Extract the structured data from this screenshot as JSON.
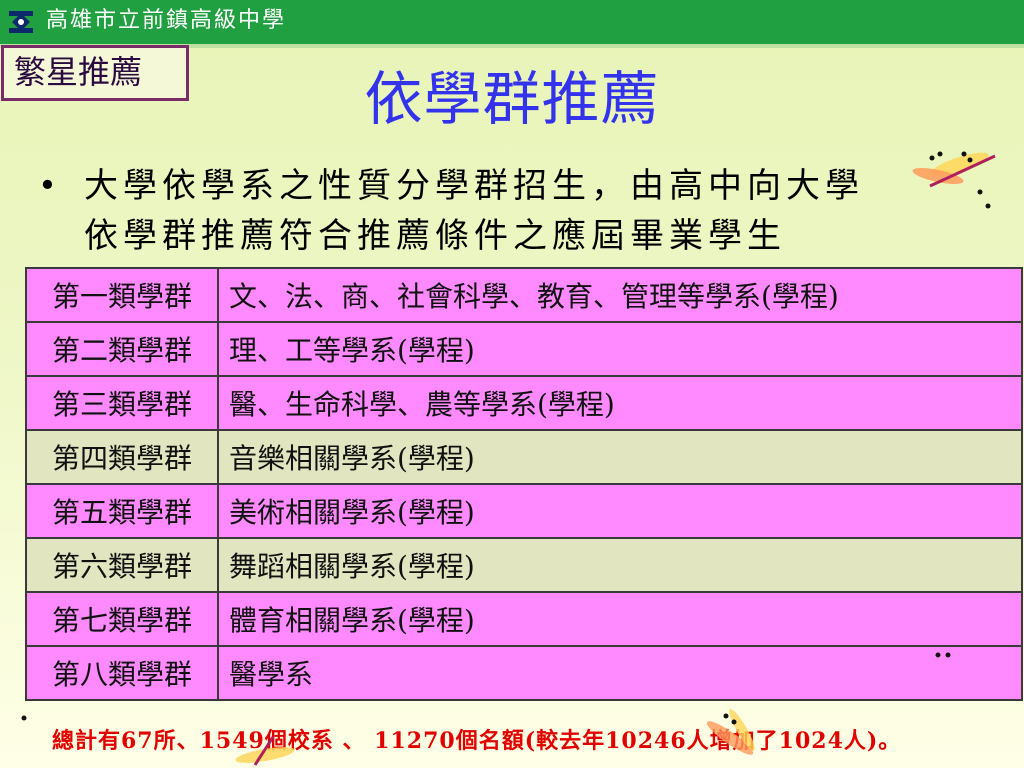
{
  "header": {
    "school_name": "高雄市立前鎮高級中學",
    "logo_icon": "school-emblem-icon",
    "background_color": "#21a041"
  },
  "tag": {
    "label": "繁星推薦"
  },
  "slide": {
    "title": "依學群推薦"
  },
  "bullet": {
    "line1": "大學依學系之性質分學群招生，由高中向大學",
    "line2": "依學群推薦符合推薦條件之應屆畢業學生"
  },
  "groups": [
    {
      "name": "第一類學群",
      "departments": "文、法、商、社會科學、教育、管理等學系(學程)",
      "color": "pink"
    },
    {
      "name": "第二類學群",
      "departments": "理、工等學系(學程)",
      "color": "pink"
    },
    {
      "name": "第三類學群",
      "departments": "醫、生命科學、農等學系(學程)",
      "color": "pink"
    },
    {
      "name": "第四類學群",
      "departments": "音樂相關學系(學程)",
      "color": "olive"
    },
    {
      "name": "第五類學群",
      "departments": "美術相關學系(學程)",
      "color": "pink"
    },
    {
      "name": "第六類學群",
      "departments": "舞蹈相關學系(學程)",
      "color": "olive"
    },
    {
      "name": "第七類學群",
      "departments": "體育相關學系(學程)",
      "color": "pink"
    },
    {
      "name": "第八類學群",
      "departments": "醫學系",
      "color": "pink"
    }
  ],
  "footer": {
    "note": "總計有67所、1549個校系 、 11270個名額(較去年10246人增加了1024人)。"
  },
  "colors": {
    "title": "#3333ee",
    "row_pink": "#ff8aff",
    "row_olive": "#e2e6c0",
    "footer_text": "#e00000"
  },
  "decorations": [
    "dragonfly-icon",
    "dragonfly-icon"
  ]
}
